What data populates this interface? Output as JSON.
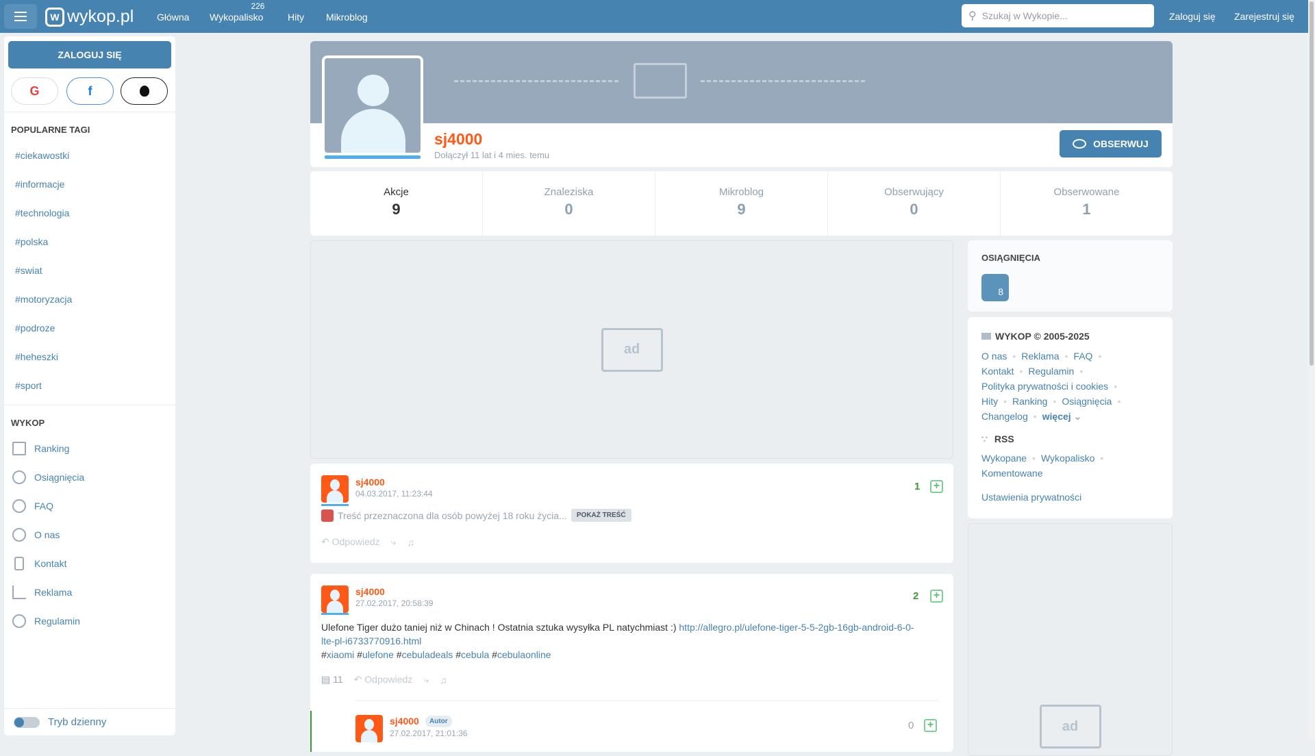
{
  "header": {
    "logo": "wykop.pl",
    "nav": [
      {
        "label": "Główna"
      },
      {
        "label": "Wykopalisko",
        "badge": "226"
      },
      {
        "label": "Hity"
      },
      {
        "label": "Mikroblog"
      }
    ],
    "search_placeholder": "Szukaj w Wykopie...",
    "login": "Zaloguj się",
    "register": "Zarejestruj się"
  },
  "sidebar": {
    "login_button": "ZALOGUJ SIĘ",
    "social": {
      "google": "G",
      "facebook": "f",
      "apple": ""
    },
    "popular_tags_title": "POPULARNE TAGI",
    "tags": [
      "#ciekawostki",
      "#informacje",
      "#technologia",
      "#polska",
      "#swiat",
      "#motoryzacja",
      "#podroze",
      "#heheszki",
      "#sport"
    ],
    "wykop_title": "WYKOP",
    "items": [
      "Ranking",
      "Osiągnięcia",
      "FAQ",
      "O nas",
      "Kontakt",
      "Reklama",
      "Regulamin"
    ],
    "theme_label": "Tryb dzienny"
  },
  "profile": {
    "username": "sj4000",
    "joined": "Dołączył 11 lat i 4 mies. temu",
    "follow_button": "OBSERWUJ",
    "stats": [
      {
        "label": "Akcje",
        "value": "9"
      },
      {
        "label": "Znaleziska",
        "value": "0"
      },
      {
        "label": "Mikroblog",
        "value": "9"
      },
      {
        "label": "Obserwujący",
        "value": "0"
      },
      {
        "label": "Obserwowane",
        "value": "1"
      }
    ]
  },
  "ad": {
    "label": "ad"
  },
  "posts": [
    {
      "author": "sj4000",
      "date": "04.03.2017, 11:23:44",
      "votes": "1",
      "nsfw_text": "Treść przeznaczona dla osób powyżej 18 roku życia...",
      "show_button": "POKAŻ TREŚĆ",
      "reply": "Odpowiedz"
    },
    {
      "author": "sj4000",
      "date": "27.02.2017, 20:58:39",
      "votes": "2",
      "text": "Ulefone Tiger dużo taniej niż w Chinach ! Ostatnia sztuka wysyłka PL natychmiast :) ",
      "url": "http://allegro.pl/ulefone-tiger-5-5-2gb-16gb-android-6-0-lte-pl-i6733770916.html",
      "tags": [
        "xiaomi",
        "ulefone",
        "cebuladeals",
        "cebula",
        "cebulaonline"
      ],
      "comments": "11",
      "reply": "Odpowiedz",
      "comment": {
        "author": "sj4000",
        "badge": "Autor",
        "date": "27.02.2017, 21:01:36",
        "votes": "0"
      }
    }
  ],
  "right": {
    "achievements_title": "OSIĄGNIĘCIA",
    "achievement_badge": "8",
    "footer_title": "WYKOP © 2005-2025",
    "footer_links": [
      "O nas",
      "Reklama",
      "FAQ",
      "Kontakt",
      "Regulamin",
      "Polityka prywatności i cookies",
      "Hity",
      "Ranking",
      "Osiągnięcia",
      "Changelog"
    ],
    "more": "więcej",
    "rss_title": "RSS",
    "rss_links": [
      "Wykopane",
      "Wykopalisko",
      "Komentowane"
    ],
    "privacy": "Ustawienia prywatności"
  }
}
